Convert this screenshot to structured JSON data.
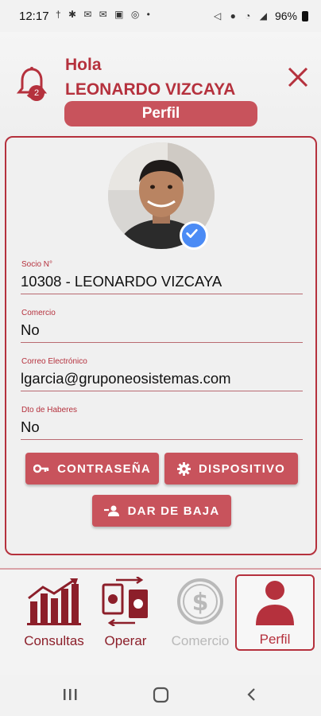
{
  "status_bar": {
    "time": "12:17",
    "battery": "96%"
  },
  "header": {
    "greeting": "Hola",
    "user_name": "LEONARDO VIZCAYA",
    "notification_count": "2",
    "section_title": "Perfil"
  },
  "profile": {
    "fields": [
      {
        "label": "Socio N°",
        "value": "10308 - LEONARDO VIZCAYA"
      },
      {
        "label": "Comercio",
        "value": "No"
      },
      {
        "label": "Correo Electrónico",
        "value": "lgarcia@gruponeosistemas.com"
      },
      {
        "label": "Dto de Haberes",
        "value": "No"
      }
    ],
    "buttons": {
      "password": "CONTRASEÑA",
      "device": "DISPOSITIVO",
      "unsubscribe": "DAR DE BAJA"
    }
  },
  "bottom_nav": {
    "items": [
      {
        "label": "Consultas"
      },
      {
        "label": "Operar"
      },
      {
        "label": "Comercio"
      },
      {
        "label": "Perfil"
      }
    ]
  },
  "colors": {
    "accent": "#b5313d",
    "button": "#c8535c",
    "disabled": "#b9b9b9"
  }
}
